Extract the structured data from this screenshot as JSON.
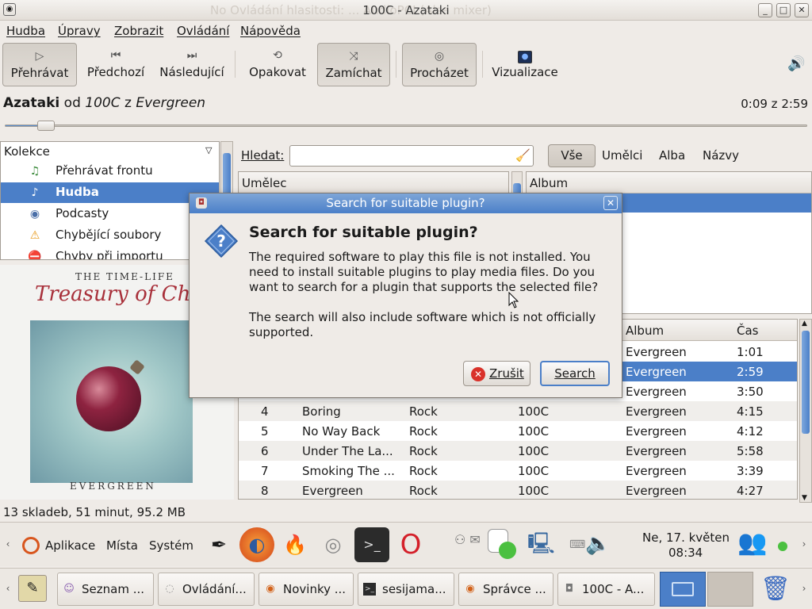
{
  "window": {
    "title": "100C - Azataki",
    "ghost_title": "No  Ovládání hlasitosti: ... AudioPCI (Alsa mixer)"
  },
  "menubar": [
    "Hudba",
    "Úpravy",
    "Zobrazit",
    "Ovládání",
    "Nápověda"
  ],
  "toolbar": {
    "play": "Přehrávat",
    "prev": "Předchozí",
    "next": "Následující",
    "repeat": "Opakovat",
    "shuffle": "Zamíchat",
    "browse": "Procházet",
    "visualize": "Vizualizace"
  },
  "now_playing": {
    "song": "Azataki",
    "by": "od",
    "artist": "100C",
    "from": "z",
    "album": "Evergreen",
    "time": "0:09 z 2:59",
    "progress": 0.05
  },
  "sources": {
    "header": "Kolekce",
    "items": [
      {
        "label": "Přehrávat frontu",
        "icon": "playlist-icon"
      },
      {
        "label": "Hudba",
        "icon": "music-note-icon"
      },
      {
        "label": "Podcasty",
        "icon": "podcast-icon"
      },
      {
        "label": "Chybějící soubory",
        "icon": "warning-icon"
      },
      {
        "label": "Chyby při importu",
        "icon": "error-icon"
      }
    ]
  },
  "album_art": {
    "top_text": "THE TIME-LIFE",
    "script_text": "Treasury of Christmas",
    "bottom_text": "EVERGREEN"
  },
  "search": {
    "label": "Hledat:",
    "value": "",
    "filters": [
      "Vše",
      "Umělci",
      "Alba",
      "Názvy"
    ]
  },
  "browser": {
    "artist_header": "Umělec",
    "album_header": "Album"
  },
  "tracks": {
    "columns": [
      "Album",
      "Čas"
    ],
    "rows": [
      {
        "no": "",
        "title": "",
        "genre": "",
        "artist": "",
        "album": "Evergreen",
        "time": "1:01"
      },
      {
        "no": "",
        "title": "",
        "genre": "",
        "artist": "",
        "album": "Evergreen",
        "time": "2:59"
      },
      {
        "no": "",
        "title": "",
        "genre": "",
        "artist": "",
        "album": "Evergreen",
        "time": "3:50"
      },
      {
        "no": "4",
        "title": "Boring",
        "genre": "Rock",
        "artist": "100C",
        "album": "Evergreen",
        "time": "4:15"
      },
      {
        "no": "5",
        "title": "No Way Back",
        "genre": "Rock",
        "artist": "100C",
        "album": "Evergreen",
        "time": "4:12"
      },
      {
        "no": "6",
        "title": "Under The La...",
        "genre": "Rock",
        "artist": "100C",
        "album": "Evergreen",
        "time": "5:58"
      },
      {
        "no": "7",
        "title": "Smoking The ...",
        "genre": "Rock",
        "artist": "100C",
        "album": "Evergreen",
        "time": "3:39"
      },
      {
        "no": "8",
        "title": "Evergreen",
        "genre": "Rock",
        "artist": "100C",
        "album": "Evergreen",
        "time": "4:27"
      }
    ]
  },
  "status": "13 skladeb, 51 minut, 95.2 MB",
  "dialog": {
    "title": "Search for suitable plugin?",
    "heading": "Search for suitable plugin?",
    "body1": "The required software to play this file is not installed. You need to install suitable plugins to play media files. Do you want to search for a plugin that supports the selected file?",
    "body2": "The search will also include software which is not officially supported.",
    "cancel": "Zrušit",
    "search": "Search"
  },
  "panel": {
    "applications": "Aplikace",
    "places": "Místa",
    "system": "Systém",
    "clock_date": "Ne, 17. květen",
    "clock_time": "08:34"
  },
  "taskbar": [
    {
      "label": "Seznam ...",
      "icon": "chat-icon"
    },
    {
      "label": "Ovládání...",
      "icon": "volume-control-icon"
    },
    {
      "label": "Novinky ...",
      "icon": "firefox-icon"
    },
    {
      "label": "sesijama...",
      "icon": "terminal-icon"
    },
    {
      "label": "Správce ...",
      "icon": "firefox-icon"
    },
    {
      "label": "100C - A...",
      "icon": "speaker-icon"
    }
  ],
  "colors": {
    "selection": "#4b7fc8",
    "dialog_title": "#5a8ad0",
    "cancel_red": "#d9312a"
  }
}
